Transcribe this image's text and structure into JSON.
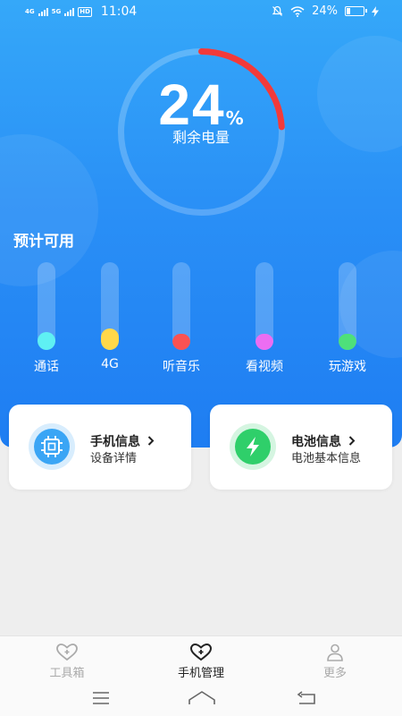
{
  "status_bar": {
    "network_1": "4G",
    "network_2": "5G",
    "hd_badge": "HD",
    "time": "11:04",
    "battery_text": "24%",
    "battery_level": 0.24,
    "icons": [
      "silent-icon",
      "wifi-icon",
      "battery-icon",
      "charging-icon"
    ]
  },
  "battery": {
    "percent_value": "24",
    "percent_symbol": "%",
    "level": 0.24,
    "label": "剩余电量",
    "ring_color": "#f23a3a"
  },
  "estimate": {
    "title": "预计可用",
    "items": [
      {
        "label": "通话",
        "color": "#5ff0f3",
        "level": 0.2
      },
      {
        "label": "4G",
        "color": "#ffd84a",
        "level": 0.24
      },
      {
        "label": "听音乐",
        "color": "#fa5252",
        "level": 0.15
      },
      {
        "label": "看视频",
        "color": "#ec6df2",
        "level": 0.12
      },
      {
        "label": "玩游戏",
        "color": "#4ee07a",
        "level": 0.1
      }
    ]
  },
  "cards": [
    {
      "title": "手机信息",
      "subtitle": "设备详情",
      "icon": "chip-icon",
      "color": "#3aa5f5"
    },
    {
      "title": "电池信息",
      "subtitle": "电池基本信息",
      "icon": "lightning-icon",
      "color": "#2fcf6a"
    }
  ],
  "bottom_nav": {
    "items": [
      {
        "label": "工具箱",
        "icon": "toolbox-heart-icon",
        "active": false
      },
      {
        "label": "手机管理",
        "icon": "phone-manage-heart-icon",
        "active": true
      },
      {
        "label": "更多",
        "icon": "user-icon",
        "active": false
      }
    ],
    "active_color": "#222222",
    "inactive_color": "#aaaaaa"
  },
  "system_nav": [
    "menu-icon",
    "home-icon",
    "back-icon"
  ]
}
